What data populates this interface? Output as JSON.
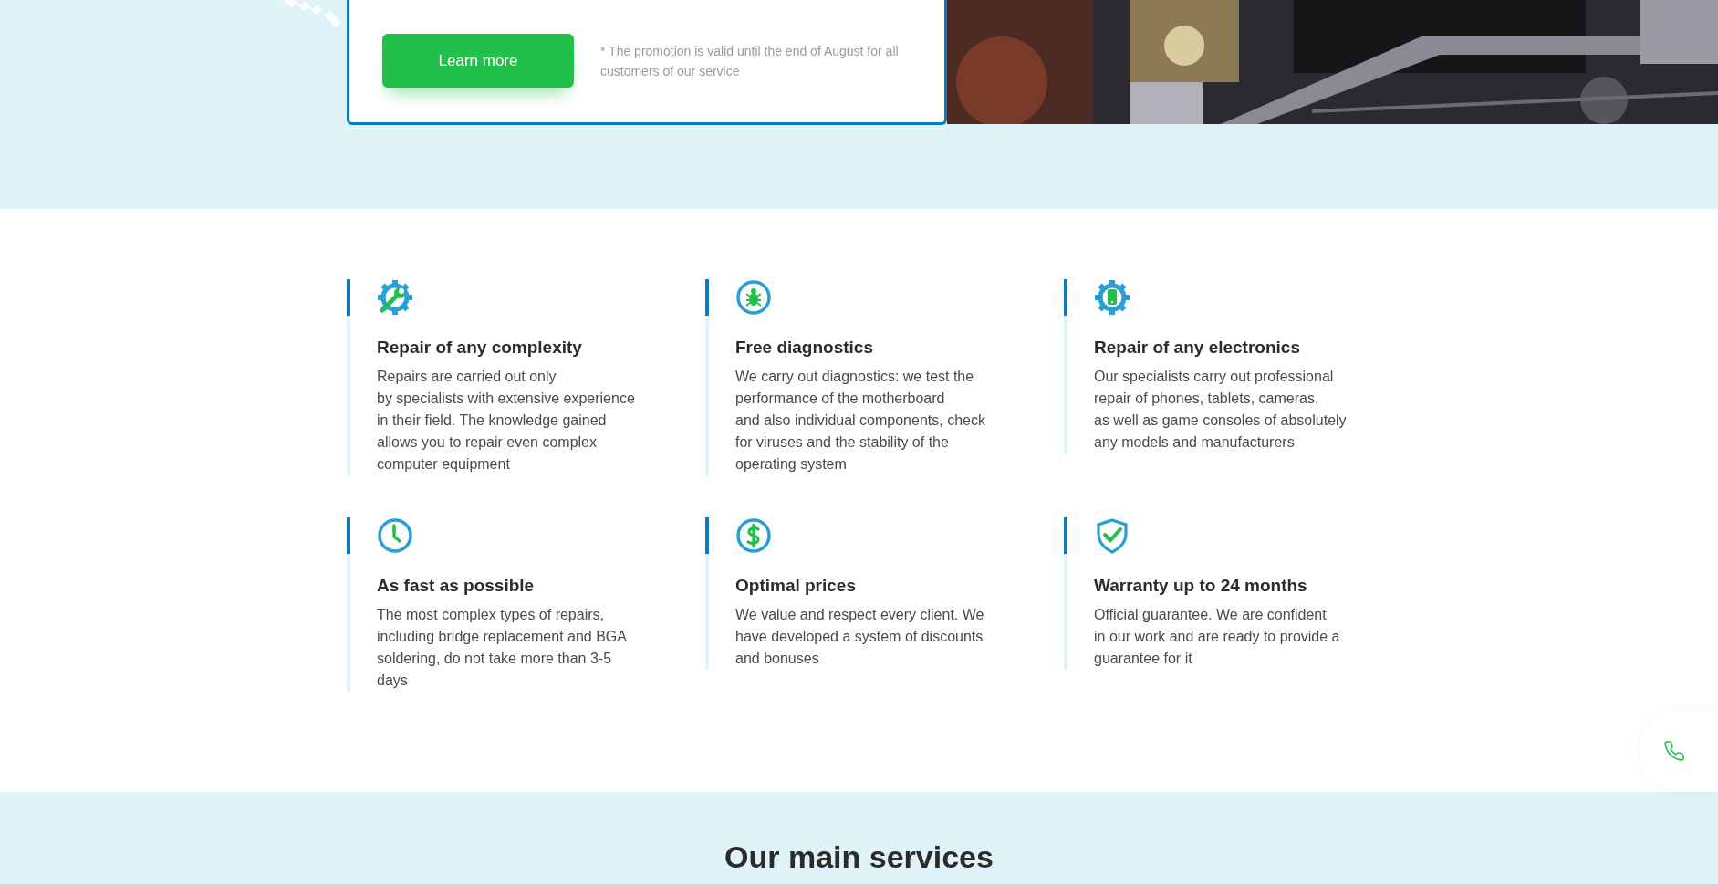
{
  "promo": {
    "button": "Learn more",
    "note": "* The promotion is valid until the end of August for all customers of our service"
  },
  "features": [
    {
      "kind": "wrench",
      "title": "Repair of any complexity",
      "text": "Repairs are carried out only\nby specialists with extensive experience\nin their field. The knowledge gained\nallows you to repair even complex\ncomputer equipment"
    },
    {
      "kind": "bug",
      "title": "Free diagnostics",
      "text": "We carry out diagnostics: we test the\nperformance of the motherboard\nand also individual components, check\nfor viruses and the stability of the\noperating system"
    },
    {
      "kind": "phone",
      "title": "Repair of any electronics",
      "text": "Our specialists carry out professional\nrepair of phones, tablets, cameras,\nas well as game consoles of absolutely\nany models and manufacturers"
    },
    {
      "kind": "clock",
      "title": "As fast as possible",
      "text": "The most complex types of repairs,\nincluding bridge replacement and BGA\nsoldering, do not take more than 3-5\ndays"
    },
    {
      "kind": "dollar",
      "title": "Optimal prices",
      "text": "We value and respect every client. We\nhave developed a system of discounts\nand bonuses"
    },
    {
      "kind": "shield",
      "title": "Warranty up to 24 months",
      "text": "Official guarantee. We are confident\nin our work and are ready to provide a\nguarantee for it"
    }
  ],
  "next_section": {
    "title": "Our main services"
  }
}
